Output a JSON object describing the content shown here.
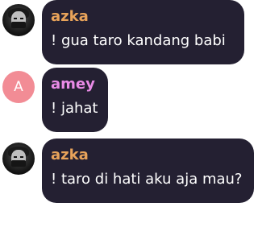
{
  "messages": [
    {
      "author": "azka",
      "author_color": "#e8a35a",
      "avatar_icon": "profile-photo",
      "text": "! gua taro kandang babi"
    },
    {
      "author": "amey",
      "author_color": "#e98be6",
      "avatar_icon": "letter-avatar",
      "avatar_letter": "A",
      "text": "! jahat"
    },
    {
      "author": "azka",
      "author_color": "#e8a35a",
      "avatar_icon": "profile-photo",
      "text": "! taro di hati aku aja mau?"
    }
  ]
}
